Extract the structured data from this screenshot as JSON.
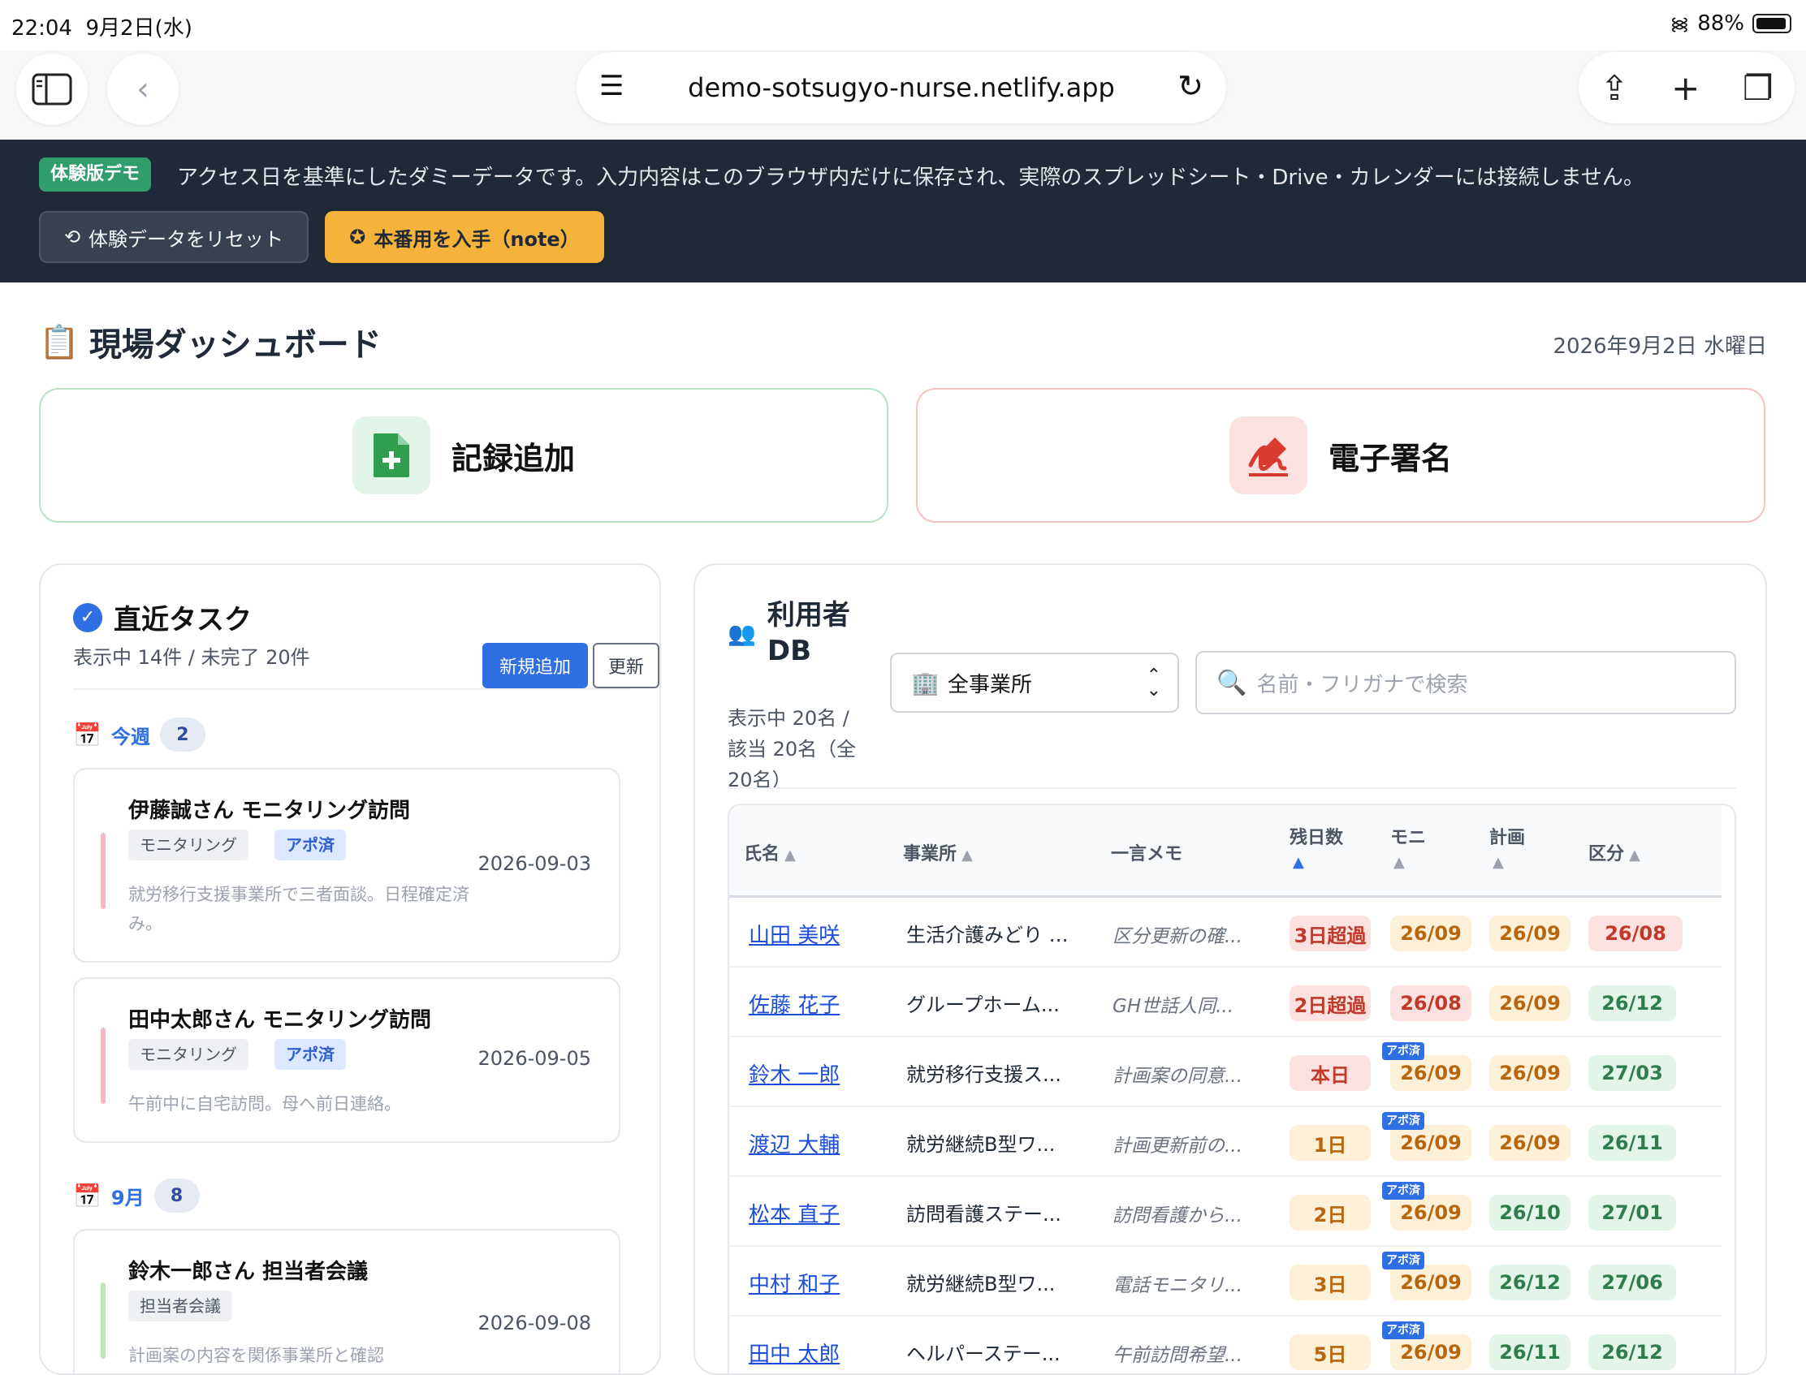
{
  "status": {
    "time": "22:04",
    "date": "9月2日(水)",
    "battery": "88%"
  },
  "browser": {
    "url": "demo-sotsugyo-nurse.netlify.app"
  },
  "banner": {
    "badge": "体験版デモ",
    "text": "アクセス日を基準にしたダミーデータです。入力内容はこのブラウザ内だけに保存され、実際のスプレッドシート・Drive・カレンダーには接続しません。",
    "reset_label": "体験データをリセット",
    "note_label": "本番用を入手（note）"
  },
  "page": {
    "title": "現場ダッシュボード",
    "date": "2026年9月2日 水曜日"
  },
  "actions": {
    "add_record": "記録追加",
    "e_signature": "電子署名"
  },
  "tasks": {
    "title": "直近タスク",
    "summary": "表示中 14件 / 未完了 20件",
    "new_label": "新規追加",
    "refresh_label": "更新",
    "groups": [
      {
        "label": "今週",
        "count": "2",
        "items": [
          {
            "title": "伊藤誠さん モニタリング訪問",
            "tags": [
              "モニタリング",
              "アポ済"
            ],
            "date": "2026-09-03",
            "note": "就労移行支援事業所で三者面談。日程確定済み。"
          },
          {
            "title": "田中太郎さん モニタリング訪問",
            "tags": [
              "モニタリング",
              "アポ済"
            ],
            "date": "2026-09-05",
            "note": "午前中に自宅訪問。母へ前日連絡。"
          }
        ]
      },
      {
        "label": "9月",
        "count": "8",
        "items": [
          {
            "title": "鈴木一郎さん 担当者会議",
            "tags": [
              "担当者会議"
            ],
            "date": "2026-09-08",
            "note": "計画案の内容を関係事業所と確認"
          }
        ]
      }
    ]
  },
  "users": {
    "title": "利用者DB",
    "summary": "表示中 20名 / 該当 20名（全20名）",
    "office_select": "全事業所",
    "search_placeholder": "名前・フリガナで検索",
    "columns": {
      "name": "氏名",
      "office": "事業所",
      "memo": "一言メモ",
      "remaining": "残日数",
      "monitoring": "モニ",
      "plan": "計画",
      "category": "区分",
      "sort_asc": "▲"
    },
    "apo_badge": "アポ済",
    "rows": [
      {
        "name": "山田 美咲",
        "office": "生活介護みどり …",
        "memo": "区分更新の確...",
        "remaining": "3日超過",
        "monitoring": "26/09",
        "plan": "26/09",
        "category": "26/08"
      },
      {
        "name": "佐藤 花子",
        "office": "グループホーム...",
        "memo": "GH世話人同...",
        "remaining": "2日超過",
        "monitoring": "26/08",
        "plan": "26/09",
        "category": "26/12"
      },
      {
        "name": "鈴木 一郎",
        "office": "就労移行支援ス...",
        "memo": "計画案の同意...",
        "remaining": "本日",
        "monitoring": "26/09",
        "plan": "26/09",
        "category": "27/03"
      },
      {
        "name": "渡辺 大輔",
        "office": "就労継続B型ワ...",
        "memo": "計画更新前の...",
        "remaining": "1日",
        "monitoring": "26/09",
        "plan": "26/09",
        "category": "26/11"
      },
      {
        "name": "松本 直子",
        "office": "訪問看護ステー...",
        "memo": "訪問看護から...",
        "remaining": "2日",
        "monitoring": "26/09",
        "plan": "26/10",
        "category": "27/01"
      },
      {
        "name": "中村 和子",
        "office": "就労継続B型ワ...",
        "memo": "電話モニタリ...",
        "remaining": "3日",
        "monitoring": "26/09",
        "plan": "26/12",
        "category": "27/06"
      },
      {
        "name": "田中 太郎",
        "office": "ヘルパーステー...",
        "memo": "午前訪問希望...",
        "remaining": "5日",
        "monitoring": "26/09",
        "plan": "26/11",
        "category": "26/12"
      }
    ]
  }
}
